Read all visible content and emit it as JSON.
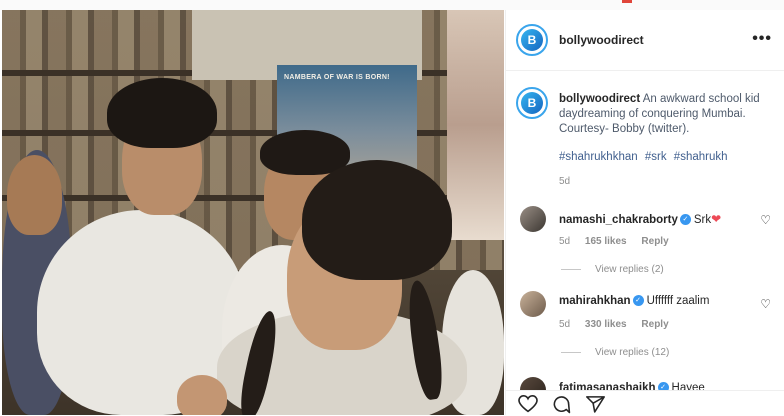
{
  "post": {
    "username": "bollywoodirect",
    "avatar_text": "B",
    "more_icon": "more-horizontal-icon",
    "caption_user": "bollywoodirect",
    "caption_text": "An awkward school kid daydreaming of conquering Mumbai. Courtesy- Bobby (twitter).",
    "hashtags": [
      "#shahrukhkhan",
      "#srk",
      "#shahrukh"
    ],
    "time": "5d"
  },
  "photo": {
    "poster_text": "NAMBERA OF WAR IS BORN!"
  },
  "comments": [
    {
      "username": "namashi_chakraborty",
      "verified": true,
      "text": "Srk",
      "emoji": "❤",
      "time": "5d",
      "likes": "165 likes",
      "reply_label": "Reply",
      "view_replies": "View replies (2)"
    },
    {
      "username": "mahirahkhan",
      "verified": true,
      "text": "Uffffff zaalim",
      "time": "5d",
      "likes": "330 likes",
      "reply_label": "Reply",
      "view_replies": "View replies (12)"
    },
    {
      "username": "fatimasanashaikh",
      "verified": true,
      "text": "Hayee"
    }
  ],
  "actions": {
    "like_icon": "heart-outline-icon",
    "comment_icon": "comment-bubble-icon",
    "share_icon": "paper-plane-icon"
  },
  "colors": {
    "accent_blue": "#3897f0",
    "hashtag_blue": "#405f8e",
    "heart_red": "#ed4956"
  }
}
